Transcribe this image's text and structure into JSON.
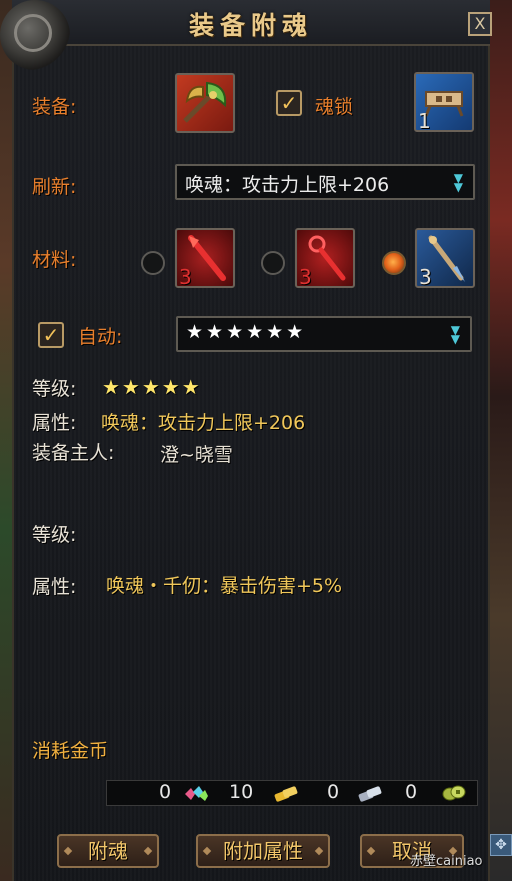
{
  "window": {
    "title": "装备附魂",
    "close_label": "X"
  },
  "equip_row": {
    "equip_label": "装备:",
    "soul_lock_label": "魂锁",
    "soul_lock_checked": true,
    "lock_slot_count": "1",
    "lock_icon": "key-lock-icon",
    "equip_icon": "battle-axe-icon"
  },
  "refresh_row": {
    "label": "刷新:",
    "selected": "唤魂：攻击力上限+206"
  },
  "material_row": {
    "label": "材料:",
    "materials": [
      {
        "count": "3",
        "icon": "red-spear-icon",
        "selected": false
      },
      {
        "count": "3",
        "icon": "red-staff-icon",
        "selected": false
      },
      {
        "count": "3",
        "icon": "blue-spike-icon",
        "selected": true
      }
    ]
  },
  "auto_row": {
    "label": "自动:",
    "checked": true,
    "selected_level": "★★★★★★"
  },
  "current": {
    "level_label": "等级:",
    "level_stars": "★★★★★",
    "attr_label": "属性:",
    "attr_value": "唤魂：攻击力上限+206",
    "owner_label": "装备主人:",
    "owner_value": "澄~晓雪"
  },
  "preview": {
    "level_label": "等级:",
    "attr_label": "属性:",
    "attr_value": "唤魂・千仞：暴击伤害+5%"
  },
  "cost": {
    "label": "消耗金币",
    "items": [
      {
        "value": "0",
        "icon": "gems-icon"
      },
      {
        "value": "10",
        "icon": "gold-ingot-icon"
      },
      {
        "value": "0",
        "icon": "silver-ingot-icon"
      },
      {
        "value": "0",
        "icon": "coins-icon"
      }
    ]
  },
  "buttons": {
    "enchant": "附魂",
    "add_attr": "附加属性",
    "cancel": "取消"
  },
  "watermark": "赤壁cainiao",
  "colors": {
    "label_orange": "#e87f2c",
    "value_gold": "#f0c75a",
    "star_yellow": "#ffe66b"
  }
}
